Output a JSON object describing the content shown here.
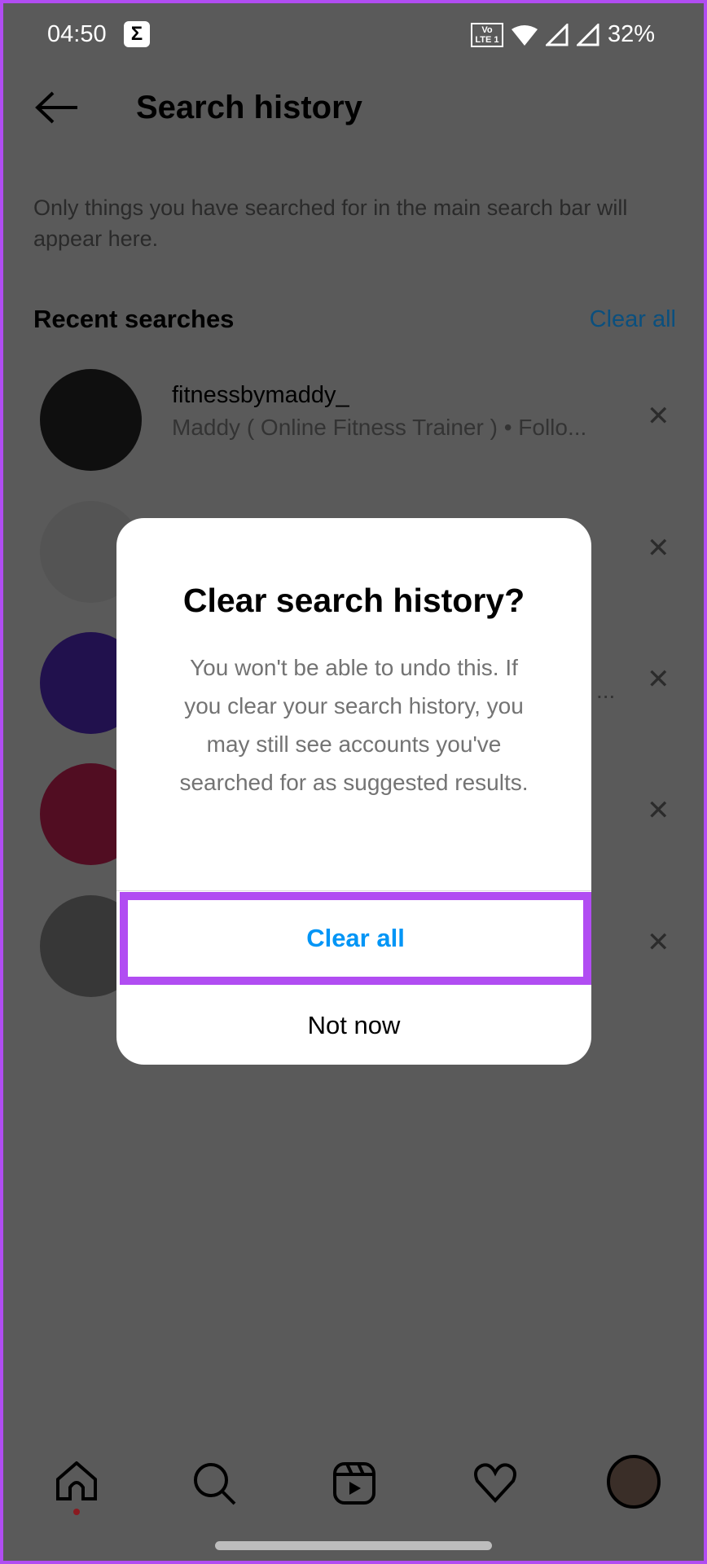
{
  "status_bar": {
    "time": "04:50",
    "notification_icon": "sigma-icon",
    "network_label": "Vo LTE 1",
    "battery": "32%"
  },
  "header": {
    "title": "Search history",
    "back_icon": "arrow-left-icon"
  },
  "description": "Only things you have searched for in the main search bar will appear here.",
  "recent": {
    "heading": "Recent searches",
    "clear_all": "Clear all",
    "items": [
      {
        "username": "fitnessbymaddy_",
        "subtitle": "Maddy ( Online Fitness Trainer ) • Follo...",
        "avatar_color": "#2a2a2a"
      },
      {
        "username": "",
        "subtitle": "",
        "avatar_color": "#e8e8e8"
      },
      {
        "username": "",
        "subtitle": "...",
        "avatar_color": "#5b2fd6"
      },
      {
        "username": "",
        "subtitle": "",
        "avatar_color": "#e0245e"
      },
      {
        "username": "",
        "subtitle": "",
        "avatar_color": "#9a9a9a"
      }
    ]
  },
  "dialog": {
    "title": "Clear search history?",
    "body": "You won't be able to undo this. If you clear your search history, you may still see accounts you've searched for as suggested results.",
    "confirm": "Clear all",
    "cancel": "Not now"
  },
  "nav": {
    "items": [
      "home-icon",
      "search-icon",
      "reels-icon",
      "heart-icon",
      "profile-avatar"
    ]
  },
  "colors": {
    "accent": "#0095f6",
    "highlight": "#b14df2",
    "overlay": "#5a5a5a"
  }
}
